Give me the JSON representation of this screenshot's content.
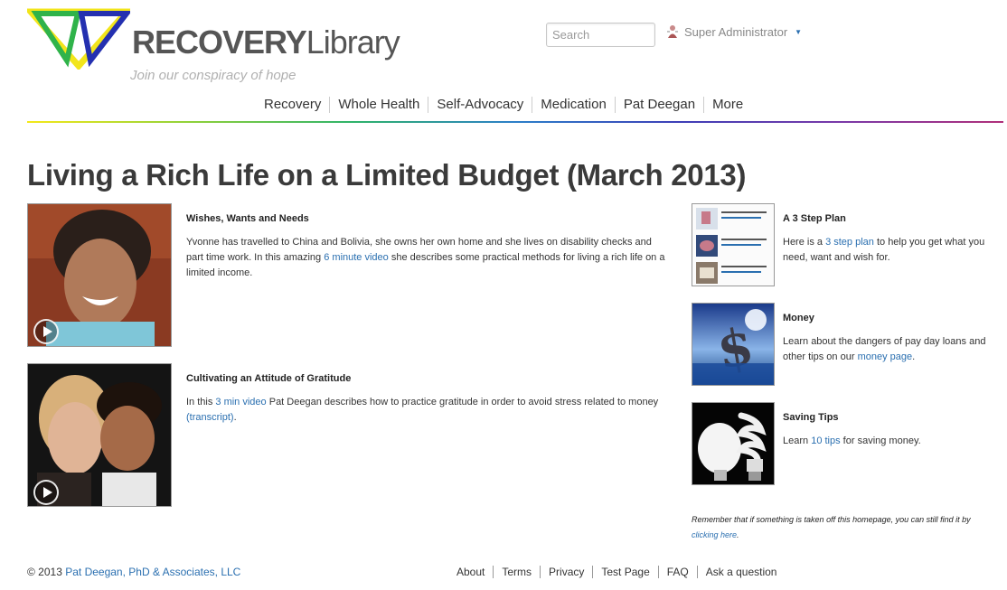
{
  "header": {
    "brand_bold": "RECOVERY",
    "brand_light": "Library",
    "tagline": "Join our conspiracy of hope",
    "search_placeholder": "Search",
    "user_label": "Super Administrator"
  },
  "nav": [
    "Recovery",
    "Whole Health",
    "Self-Advocacy",
    "Medication",
    "Pat Deegan",
    "More"
  ],
  "page_title": "Living a Rich Life on a Limited Budget (March 2013)",
  "articles": [
    {
      "title": "Wishes, Wants and Needs",
      "text_a": "Yvonne has travelled to China and Bolivia, she owns her own home and she lives on disability checks and part time work. In this amazing ",
      "link": "6 minute video",
      "text_b": " she describes some practical methods for living a rich life on a limited income."
    },
    {
      "title": "Cultivating an Attitude of Gratitude",
      "text_a": "In this ",
      "link": "3 min video",
      "text_b": " Pat Deegan describes how to practice gratitude in order to avoid stress related to money ",
      "link2": "(transcript)",
      "text_c": "."
    }
  ],
  "sidebar": [
    {
      "title": "A 3 Step Plan",
      "text_a": "Here is a ",
      "link": "3 step plan",
      "text_b": " to help you get what you need, want and wish for.",
      "thumb_lines": [
        "Step 1: Examining Your Spending",
        "Step 2: Identifying Your Needs, Wants",
        "Step 3: Practice Your Budget"
      ]
    },
    {
      "title": "Money",
      "text_a": "Learn about the dangers of pay day loans and other tips on our ",
      "link": "money page",
      "text_b": "."
    },
    {
      "title": "Saving Tips",
      "text_a": "Learn ",
      "link": "10 tips",
      "text_b": " for saving money."
    }
  ],
  "note": {
    "text": "Remember that if something is taken off this homepage, you can still find it by ",
    "link": "clicking here",
    "end": "."
  },
  "footer": {
    "copy_prefix": "© 2013 ",
    "copy_link": "Pat Deegan, PhD & Associates, LLC",
    "links": [
      "About",
      "Terms",
      "Privacy",
      "Test Page",
      "FAQ",
      "Ask a question"
    ]
  },
  "colors": {
    "link": "#2a6fb0",
    "title": "#3a3a3a",
    "brand": "#555555"
  }
}
